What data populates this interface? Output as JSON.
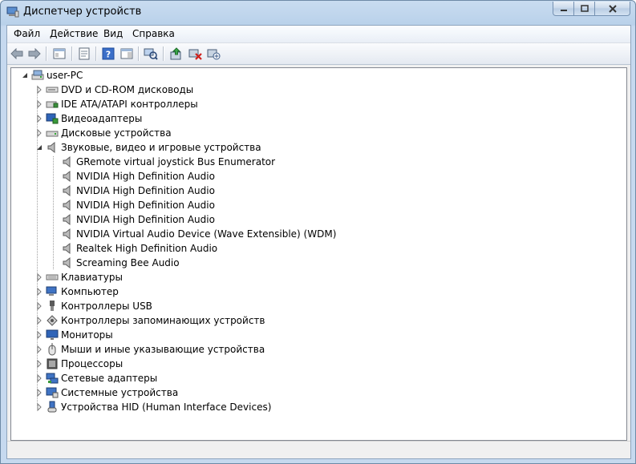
{
  "window": {
    "title": "Диспетчер устройств"
  },
  "menu": [
    "Файл",
    "Действие",
    "Вид",
    "Справка"
  ],
  "toolbar_icons": [
    "back-icon",
    "forward-icon",
    "show-hide-tree-icon",
    "properties-icon",
    "help-icon",
    "action-pane-icon",
    "scan-hardware-icon",
    "update-driver-icon",
    "uninstall-icon",
    "disable-icon"
  ],
  "tree": {
    "root": "user-PC",
    "categories": [
      {
        "label": "DVD и CD-ROM дисководы",
        "icon": "dvd-drive-icon"
      },
      {
        "label": "IDE ATA/ATAPI контроллеры",
        "icon": "ide-controller-icon"
      },
      {
        "label": "Видеоадаптеры",
        "icon": "display-adapter-icon"
      },
      {
        "label": "Дисковые устройства",
        "icon": "disk-drive-icon"
      },
      {
        "label": "Звуковые, видео и игровые устройства",
        "icon": "speaker-icon",
        "expanded": true,
        "children": [
          "GRemote virtual joystick Bus Enumerator",
          "NVIDIA High Definition Audio",
          "NVIDIA High Definition Audio",
          "NVIDIA High Definition Audio",
          "NVIDIA High Definition Audio",
          "NVIDIA Virtual Audio Device (Wave Extensible) (WDM)",
          "Realtek High Definition Audio",
          "Screaming Bee Audio"
        ]
      },
      {
        "label": "Клавиатуры",
        "icon": "keyboard-icon"
      },
      {
        "label": "Компьютер",
        "icon": "computer-icon"
      },
      {
        "label": "Контроллеры USB",
        "icon": "usb-icon"
      },
      {
        "label": "Контроллеры запоминающих устройств",
        "icon": "storage-controller-icon"
      },
      {
        "label": "Мониторы",
        "icon": "monitor-icon"
      },
      {
        "label": "Мыши и иные указывающие устройства",
        "icon": "mouse-icon"
      },
      {
        "label": "Процессоры",
        "icon": "processor-icon"
      },
      {
        "label": "Сетевые адаптеры",
        "icon": "network-adapter-icon"
      },
      {
        "label": "Системные устройства",
        "icon": "system-device-icon"
      },
      {
        "label": "Устройства HID (Human Interface Devices)",
        "icon": "hid-icon"
      }
    ]
  }
}
